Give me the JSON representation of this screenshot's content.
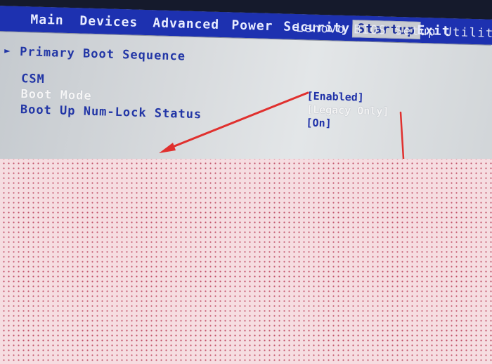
{
  "menu": {
    "items": [
      {
        "label": "Main"
      },
      {
        "label": "Devices"
      },
      {
        "label": "Advanced"
      },
      {
        "label": "Power"
      },
      {
        "label": "Security"
      },
      {
        "label": "Startup"
      },
      {
        "label": "Exit"
      }
    ],
    "active": "Startup",
    "utility_title": "Lenovo BIOS Setup Utility"
  },
  "startup": {
    "submenu_marker": "►",
    "submenu_label": "Primary Boot Sequence",
    "settings": [
      {
        "label": "CSM",
        "value": "[Enabled]",
        "highlighted": false
      },
      {
        "label": "Boot Mode",
        "value": "[Legacy Only]",
        "highlighted": true
      },
      {
        "label": "Boot Up Num-Lock Status",
        "value": "[On]",
        "highlighted": false
      }
    ]
  },
  "annotation": {
    "color": "#e0302e"
  },
  "cover": {
    "color": "#f6dde1",
    "dot_color": "#c05068"
  }
}
